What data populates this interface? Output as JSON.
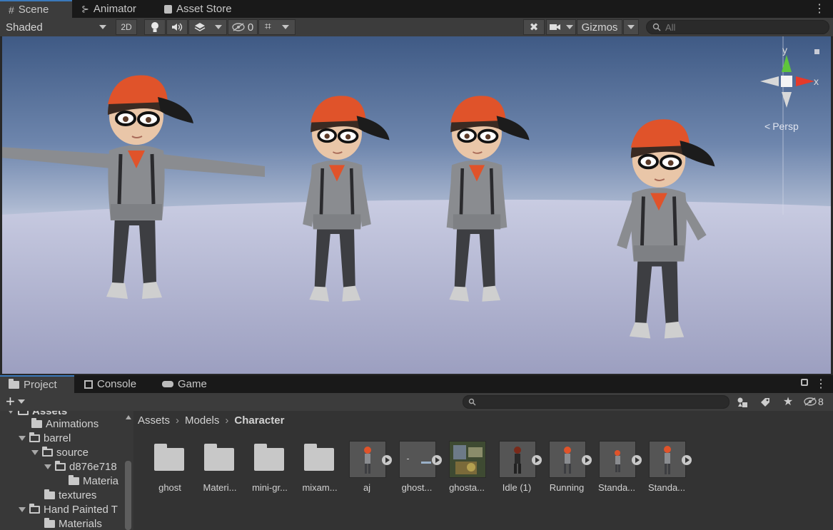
{
  "scene_tabs": [
    {
      "icon": "grid-icon",
      "label": "Scene"
    },
    {
      "icon": "animator-icon",
      "label": "Animator"
    },
    {
      "icon": "bag-icon",
      "label": "Asset Store"
    }
  ],
  "scene_toolbar": {
    "shading_mode": "Shaded",
    "two_d": "2D",
    "hidden_count": "0",
    "gizmos": "Gizmos",
    "search_placeholder": "All"
  },
  "gizmo": {
    "y": "y",
    "x": "x",
    "persp": "Persp"
  },
  "bottom_tabs": [
    {
      "icon": "folder-icon",
      "label": "Project"
    },
    {
      "icon": "console-icon",
      "label": "Console"
    },
    {
      "icon": "gamepad-icon",
      "label": "Game"
    }
  ],
  "project_toolbar": {
    "add": "+",
    "hidden_count": "8"
  },
  "tree": {
    "root": "Assets",
    "items": [
      {
        "label": "Animations"
      },
      {
        "label": "barrel"
      },
      {
        "label": "source"
      },
      {
        "label": "d876e718"
      },
      {
        "label": "Materia"
      },
      {
        "label": "textures"
      },
      {
        "label": "Hand Painted T"
      },
      {
        "label": "Materials"
      }
    ]
  },
  "breadcrumb": [
    "Assets",
    "Models",
    "Character"
  ],
  "assets": [
    {
      "label": "ghost",
      "kind": "folder"
    },
    {
      "label": "Materi...",
      "kind": "folder"
    },
    {
      "label": "mini-gr...",
      "kind": "folder"
    },
    {
      "label": "mixam...",
      "kind": "folder"
    },
    {
      "label": "aj",
      "kind": "model"
    },
    {
      "label": "ghost...",
      "kind": "model"
    },
    {
      "label": "ghosta...",
      "kind": "texture"
    },
    {
      "label": "Idle (1)",
      "kind": "model"
    },
    {
      "label": "Running",
      "kind": "model"
    },
    {
      "label": "Standa...",
      "kind": "model"
    },
    {
      "label": "Standa...",
      "kind": "model"
    }
  ],
  "colors": {
    "accent": "#3a79bb",
    "cap": "#e0532a",
    "hoodie": "#8a8c90",
    "jeans": "#3d3e42"
  }
}
